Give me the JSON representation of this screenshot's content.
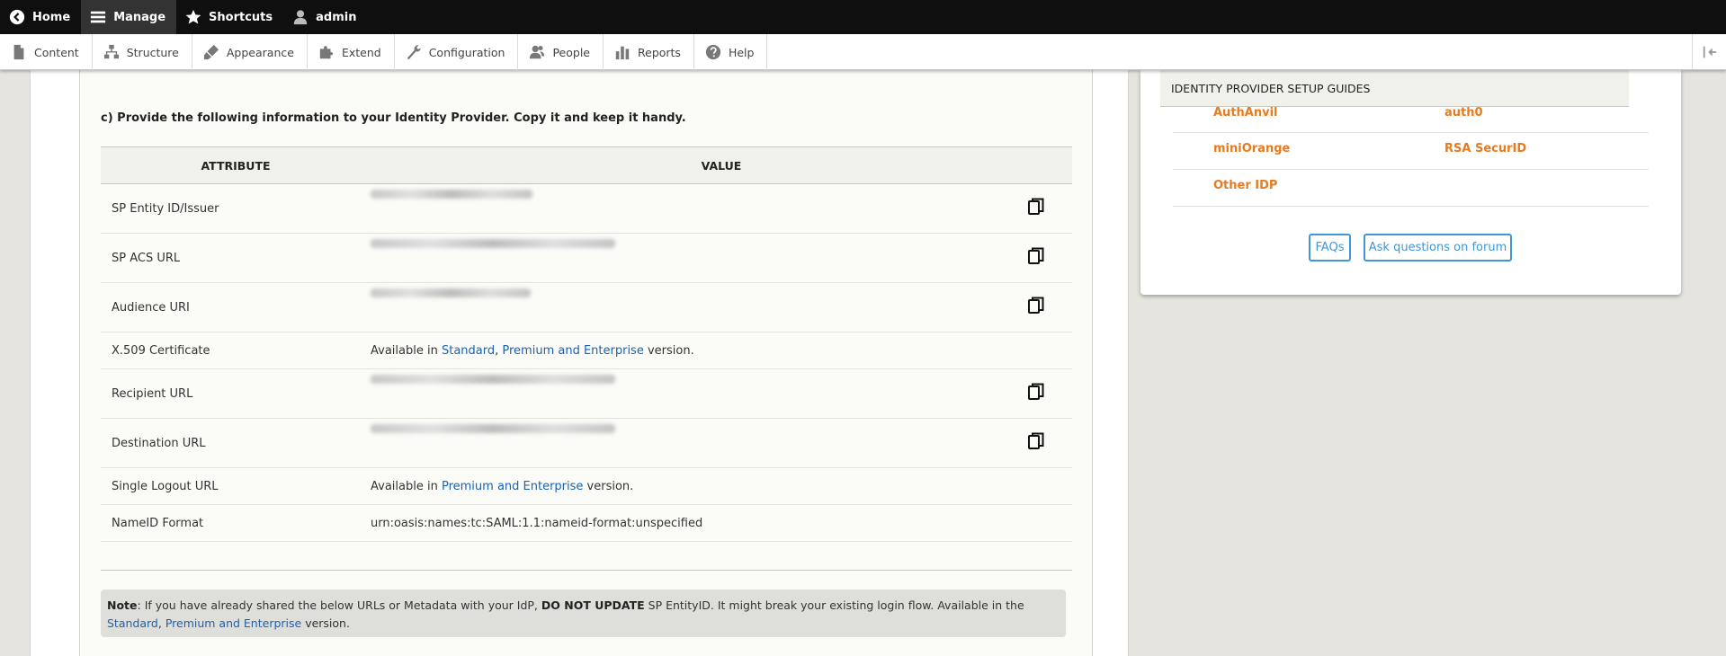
{
  "toolbar": {
    "items": [
      {
        "label": "Home",
        "icon": "back-circle-icon"
      },
      {
        "label": "Manage",
        "icon": "hamburger-icon",
        "active": true
      },
      {
        "label": "Shortcuts",
        "icon": "star-icon"
      },
      {
        "label": "admin",
        "icon": "user-icon"
      }
    ]
  },
  "tray": {
    "items": [
      {
        "label": "Content",
        "icon": "file-icon"
      },
      {
        "label": "Structure",
        "icon": "sitemap-icon"
      },
      {
        "label": "Appearance",
        "icon": "brush-icon"
      },
      {
        "label": "Extend",
        "icon": "puzzle-icon"
      },
      {
        "label": "Configuration",
        "icon": "wrench-icon"
      },
      {
        "label": "People",
        "icon": "people-icon"
      },
      {
        "label": "Reports",
        "icon": "bar-chart-icon"
      },
      {
        "label": "Help",
        "icon": "question-circle-icon"
      }
    ]
  },
  "main": {
    "instruction": "c) Provide the following information to your Identity Provider. Copy it and keep it handy.",
    "table": {
      "headers": [
        "ATTRIBUTE",
        "VALUE"
      ],
      "rows": [
        {
          "attribute": "SP Entity ID/Issuer",
          "value_obscured": true,
          "copy": true
        },
        {
          "attribute": "SP ACS URL",
          "value_obscured": true,
          "copy": true
        },
        {
          "attribute": "Audience URI",
          "value_obscured": true,
          "copy": true
        },
        {
          "attribute": "X.509 Certificate",
          "value_prefix": "Available in ",
          "links": [
            "Standard",
            "Premium and Enterprise"
          ],
          "separator": ", ",
          "value_suffix": " version."
        },
        {
          "attribute": "Recipient URL",
          "value_obscured": true,
          "copy": true
        },
        {
          "attribute": "Destination URL",
          "value_obscured": true,
          "copy": true
        },
        {
          "attribute": "Single Logout URL",
          "value_prefix": "Available in ",
          "links": [
            "Premium and Enterprise"
          ],
          "value_suffix": " version."
        },
        {
          "attribute": "NameID Format",
          "value": "urn:oasis:names:tc:SAML:1.1:nameid-format:unspecified"
        }
      ]
    },
    "note": {
      "label": "Note",
      "text1": ": If you have already shared the below URLs or Metadata with your IdP, ",
      "strong": "DO NOT UPDATE",
      "text2": " SP EntityID. It might break your existing login flow. Available in the",
      "link1": "Standard",
      "sep": ", ",
      "link2": "Premium and Enterprise",
      "text3": " version."
    }
  },
  "sidebar": {
    "guides_title": "IDENTITY PROVIDER SETUP GUIDES",
    "guides": [
      "AuthAnvil",
      "auth0",
      "miniOrange",
      "RSA SecurID",
      "Other IDP"
    ],
    "faq_button": "FAQs",
    "forum_button": "Ask questions on forum"
  },
  "colors": {
    "toolbar_bg": "#0f0f0f",
    "link_blue": "#1b62b1",
    "guide_orange": "#e87b1f",
    "button_blue": "#3f97d4"
  }
}
